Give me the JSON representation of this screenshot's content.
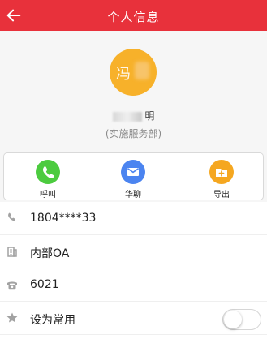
{
  "header": {
    "title": "个人信息"
  },
  "profile": {
    "avatar_text": "冯",
    "name_fragment": "明",
    "department": "(实施服务部)"
  },
  "actions": [
    {
      "label": "呼叫",
      "color": "#4ccb3f",
      "icon": "phone-icon"
    },
    {
      "label": "华聊",
      "color": "#4b84f0",
      "icon": "message-icon"
    },
    {
      "label": "导出",
      "color": "#f5a720",
      "icon": "export-folder-icon"
    }
  ],
  "info_rows": [
    {
      "icon": "phone-icon",
      "text": "1804****33"
    },
    {
      "icon": "building-icon",
      "text": "内部OA"
    },
    {
      "icon": "telephone-icon",
      "text": "6021"
    },
    {
      "icon": "star-icon",
      "text": "设为常用"
    }
  ],
  "toggle": {
    "enabled": false
  }
}
